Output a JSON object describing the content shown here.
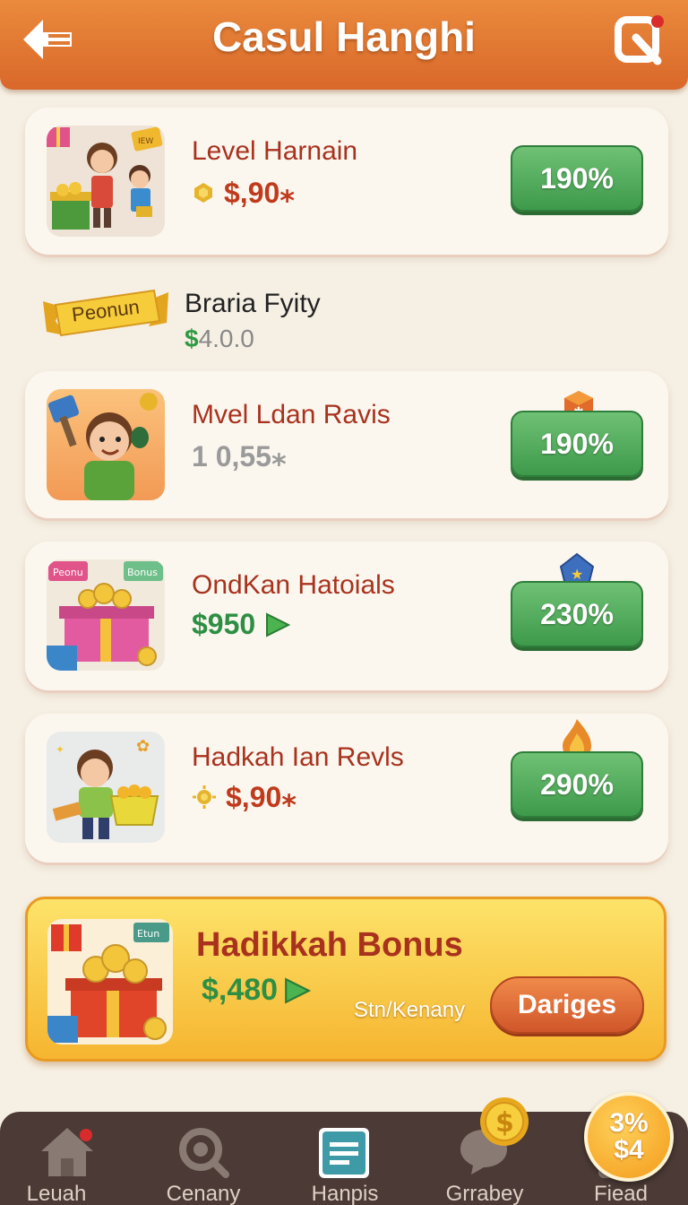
{
  "header": {
    "title": "Casul Hanghi"
  },
  "items": [
    {
      "title": "Level Harnain",
      "value": "$,90⁎",
      "button": "190%"
    },
    {
      "title": "Mvel Ldan Ravis",
      "value": "1 0,55⁎",
      "button": "190%"
    },
    {
      "title": "OndKan Hatoials",
      "value": "$950",
      "button": "230%"
    },
    {
      "title": "Hadkah Ian Revls",
      "value": "$,90⁎",
      "button": "290%"
    }
  ],
  "promo": {
    "ribbon": "Peonun",
    "name": "Braria Fyity",
    "price_symbol": "$",
    "price_rest": "4.0.0"
  },
  "thumb_labels": {
    "item1_tag": "IEW",
    "item3_left": "Peonu",
    "item3_right": "Bonus"
  },
  "bonus": {
    "title": "Hadikkah Bonus",
    "value": "$,480",
    "subtitle": "Stn/Kenany",
    "button": "Dariges",
    "tag": "Etun"
  },
  "tabs": [
    {
      "label": "Leuah",
      "icon": "home-icon"
    },
    {
      "label": "Cenany",
      "icon": "search-icon"
    },
    {
      "label": "Hanpis",
      "icon": "list-icon"
    },
    {
      "label": "Grrabey",
      "icon": "chat-icon"
    },
    {
      "label": "Fiead",
      "icon": "profile-icon"
    }
  ],
  "corner_badge": {
    "line1": "3%",
    "line2": "$4"
  },
  "colors": {
    "header": "#e07a33",
    "green_button": "#4ba858",
    "title_red": "#a8321e",
    "bonus_yellow": "#fbd24f"
  }
}
